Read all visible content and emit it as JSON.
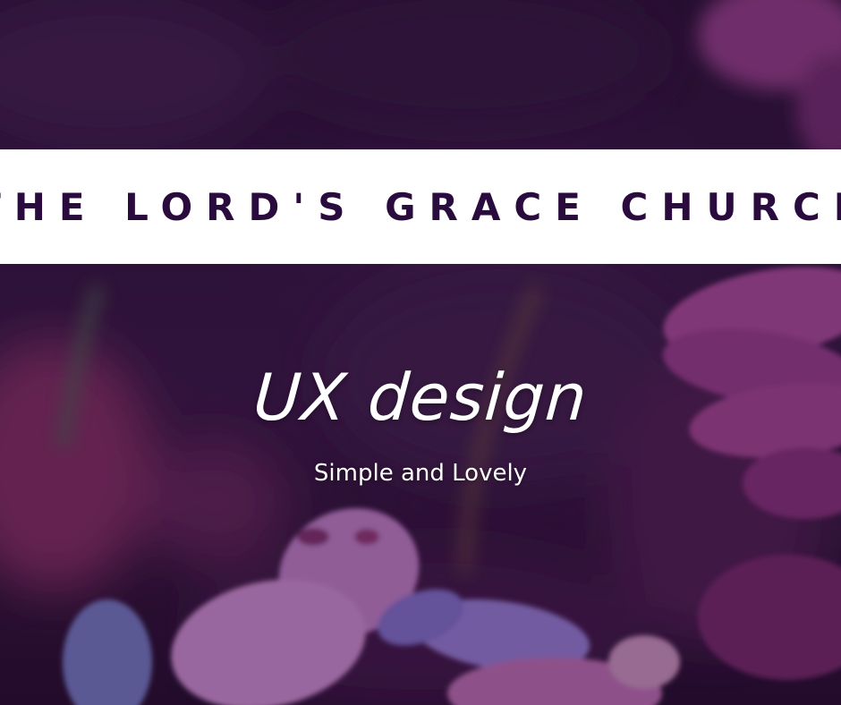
{
  "banner": {
    "title": "THE LORD'S GRACE CHURCH"
  },
  "headline": "UX design",
  "subline": "Simple and Lovely",
  "colors": {
    "banner_background": "#ffffff",
    "banner_text": "#2a0b3d",
    "overlay_text": "#ffffff",
    "background_base": "#2c1236"
  }
}
